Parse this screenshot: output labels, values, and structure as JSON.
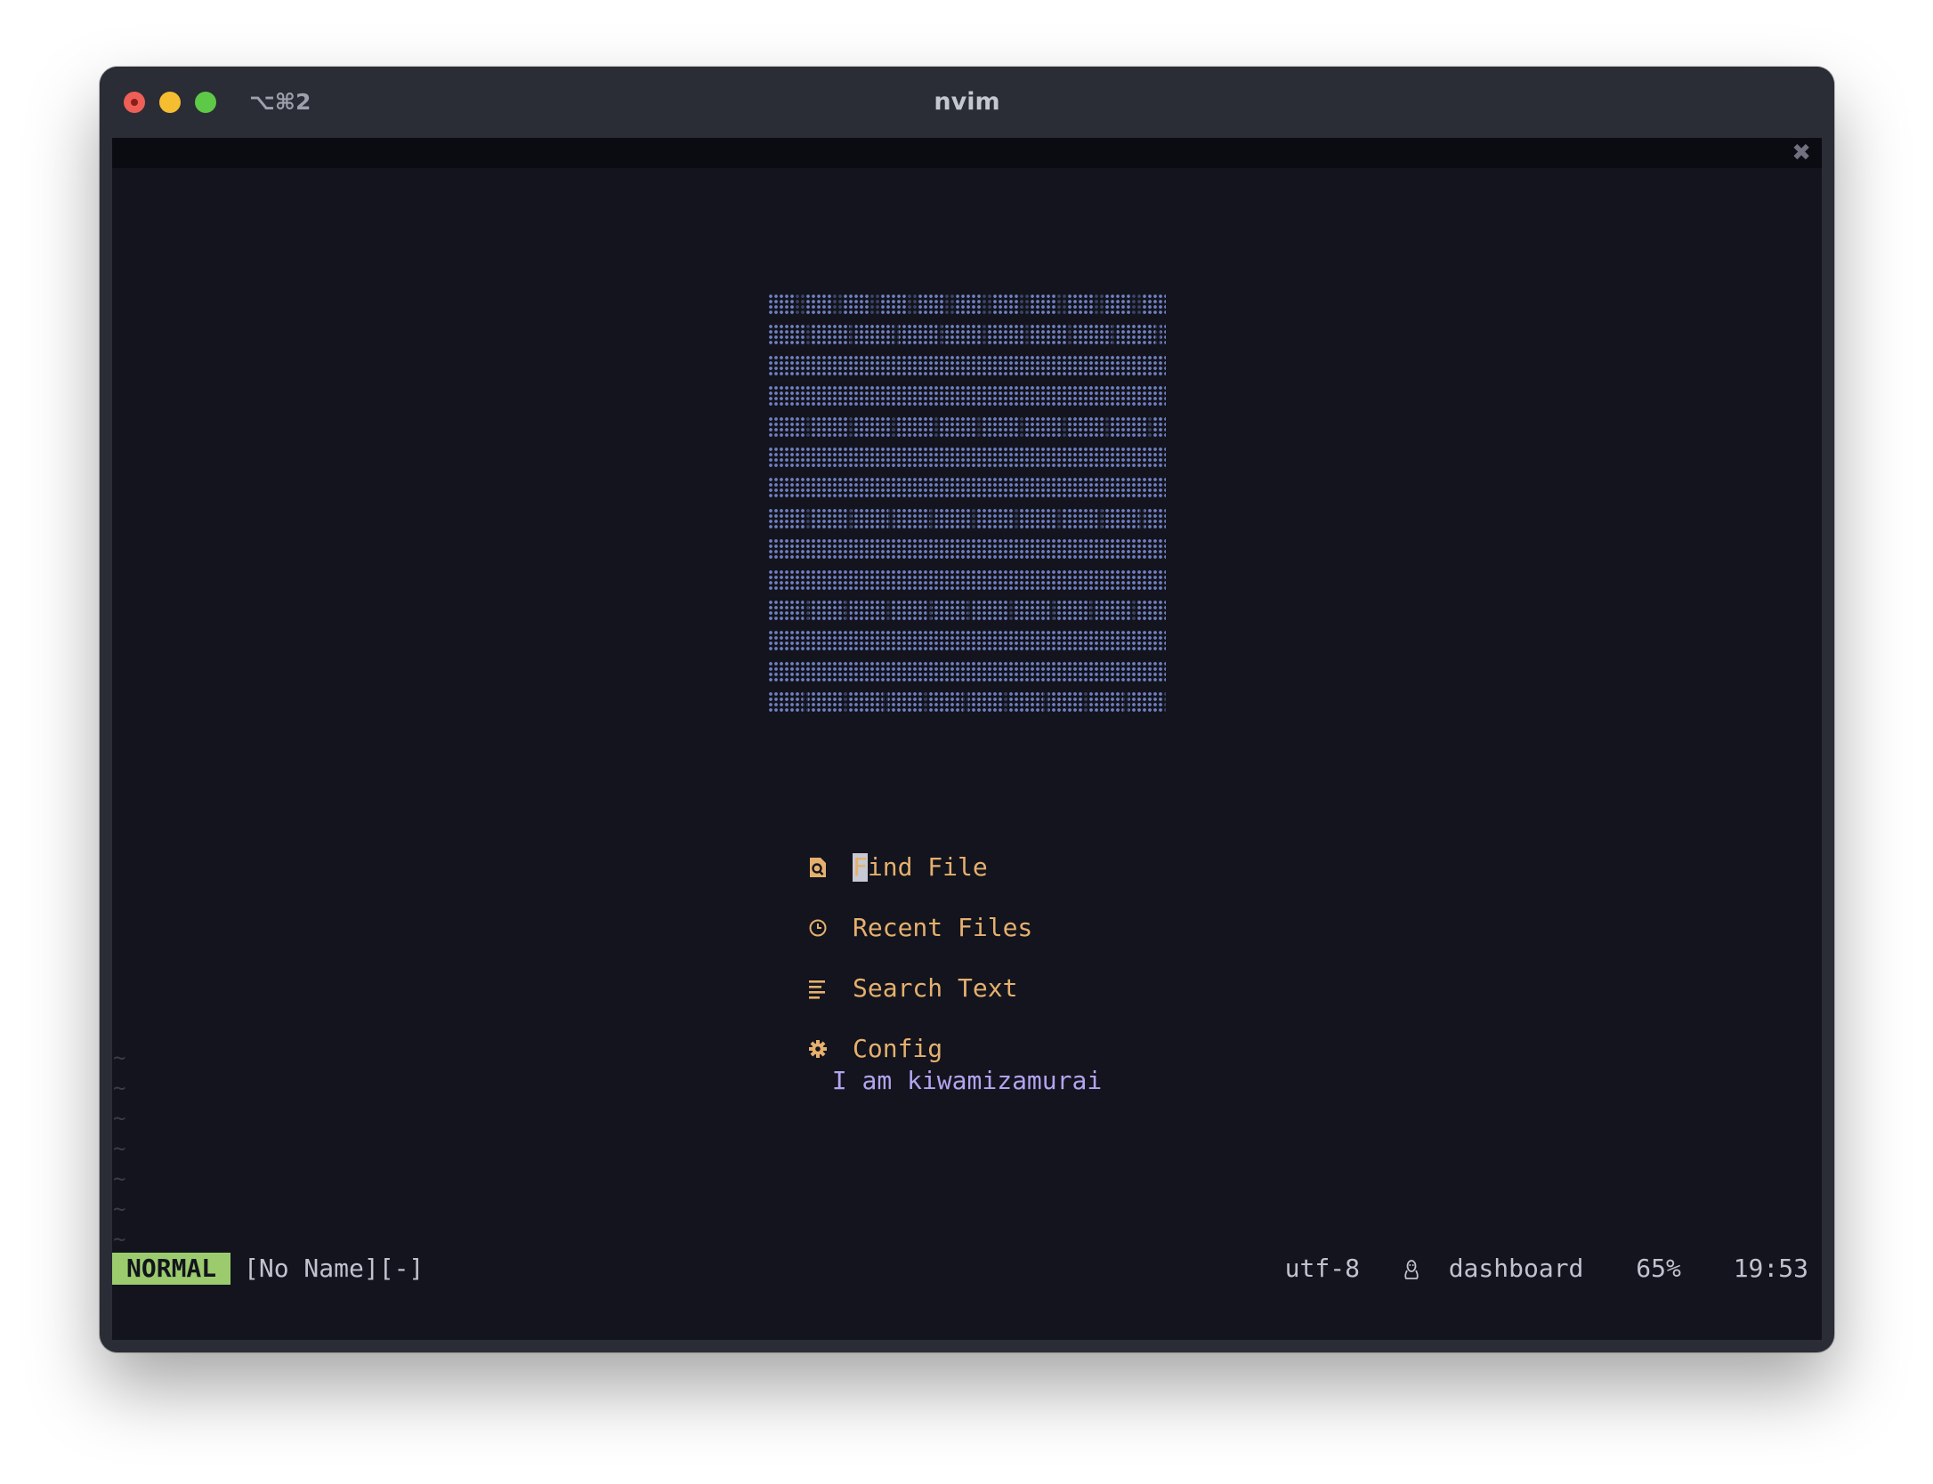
{
  "window": {
    "shortcut": "⌥⌘2",
    "title": "nvim",
    "tab_close_glyph": "✖"
  },
  "dashboard": {
    "ascii_art_rows": 14,
    "menu": [
      {
        "icon": "search-file-icon",
        "label": "Find File"
      },
      {
        "icon": "clock-icon",
        "label": "Recent Files"
      },
      {
        "icon": "text-lines-icon",
        "label": "Search Text"
      },
      {
        "icon": "gear-icon",
        "label": "Config"
      }
    ],
    "footer": "I am kiwamizamurai"
  },
  "statusline": {
    "mode": "NORMAL",
    "filename": "[No Name][-]",
    "encoding": "utf-8",
    "os_icon": "linux-icon",
    "filetype": "dashboard",
    "progress": "65%",
    "position": "19:53"
  },
  "colors": {
    "background": "#13141d",
    "menu_text": "#e5b06e",
    "footer_text": "#b2a4f0",
    "ascii_art": "#6f80c2",
    "mode_bg": "#9ccb6e"
  }
}
